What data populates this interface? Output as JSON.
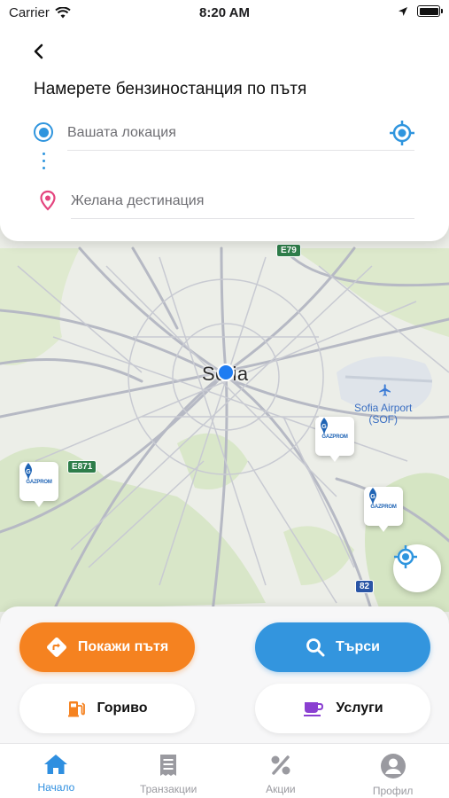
{
  "status_bar": {
    "carrier": "Carrier",
    "time": "8:20 AM"
  },
  "header": {
    "title": "Намерете бензиностанция по пътя",
    "from_placeholder": "Вашата локация",
    "to_placeholder": "Желана дестинация"
  },
  "map": {
    "city": "Sofia",
    "airport": "Sofia Airport\n(SOF)",
    "road_shields": [
      "E79",
      "E871",
      "82"
    ],
    "marker_brand": "GAZPROM"
  },
  "actions": {
    "route_label": "Покажи пътя",
    "search_label": "Търси",
    "fuel_label": "Гориво",
    "services_label": "Услуги"
  },
  "tabs": [
    {
      "label": "Начало",
      "icon": "home-icon",
      "active": true
    },
    {
      "label": "Транзакции",
      "icon": "receipt-icon",
      "active": false
    },
    {
      "label": "Акции",
      "icon": "percent-icon",
      "active": false
    },
    {
      "label": "Профил",
      "icon": "profile-icon",
      "active": false
    }
  ],
  "colors": {
    "accent_blue": "#3395de",
    "accent_orange": "#f58220",
    "pin_pink": "#e4447e"
  }
}
